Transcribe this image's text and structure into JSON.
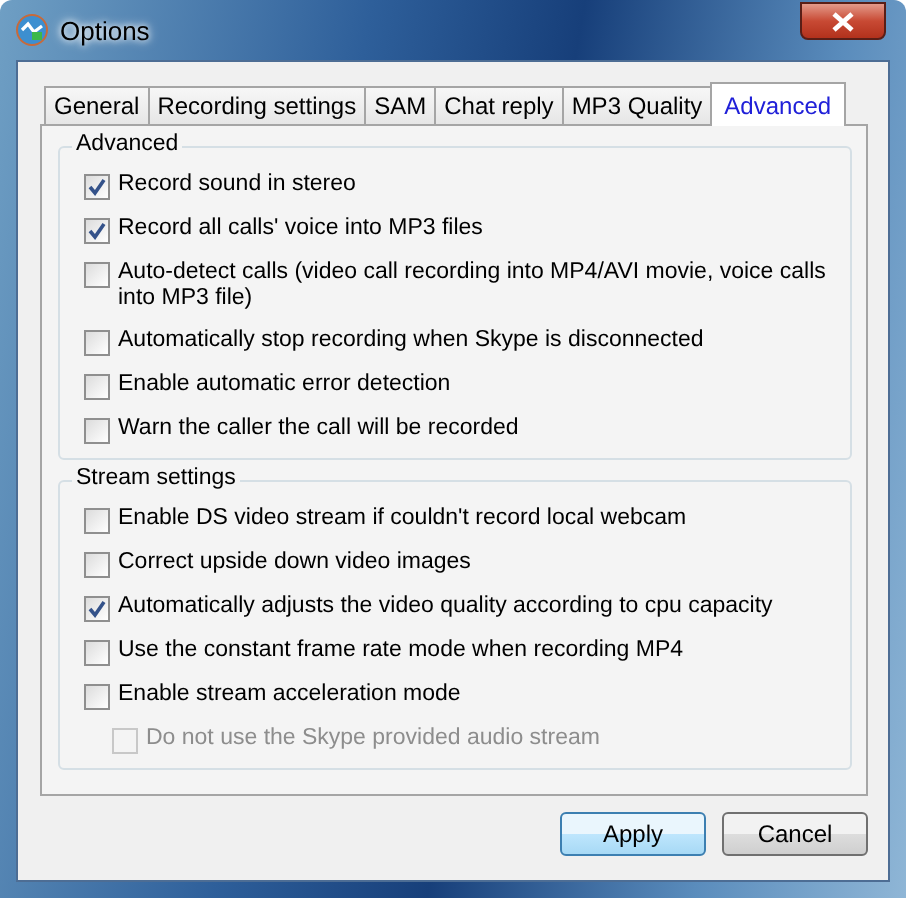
{
  "window": {
    "title": "Options"
  },
  "tabs": [
    {
      "label": "General",
      "selected": false
    },
    {
      "label": "Recording settings",
      "selected": false
    },
    {
      "label": "SAM",
      "selected": false
    },
    {
      "label": "Chat reply",
      "selected": false
    },
    {
      "label": "MP3 Quality",
      "selected": false
    },
    {
      "label": "Advanced",
      "selected": true
    }
  ],
  "groups": [
    {
      "title": "Advanced",
      "options": [
        {
          "label": "Record sound in stereo",
          "checked": true,
          "disabled": false
        },
        {
          "label": "Record all calls' voice into MP3 files",
          "checked": true,
          "disabled": false
        },
        {
          "label": "Auto-detect calls (video call recording into MP4/AVI movie, voice calls into MP3 file)",
          "checked": false,
          "disabled": false
        },
        {
          "label": "Automatically stop recording when Skype is disconnected",
          "checked": false,
          "disabled": false
        },
        {
          "label": "Enable automatic error detection",
          "checked": false,
          "disabled": false
        },
        {
          "label": "Warn the caller the call will be recorded",
          "checked": false,
          "disabled": false
        }
      ]
    },
    {
      "title": "Stream settings",
      "options": [
        {
          "label": "Enable DS video stream if couldn't record local webcam",
          "checked": false,
          "disabled": false
        },
        {
          "label": "Correct upside down video images",
          "checked": false,
          "disabled": false
        },
        {
          "label": "Automatically adjusts the video quality according to cpu capacity",
          "checked": true,
          "disabled": false
        },
        {
          "label": "Use the constant frame rate mode when recording MP4",
          "checked": false,
          "disabled": false
        },
        {
          "label": "Enable stream acceleration mode",
          "checked": false,
          "disabled": false,
          "children": [
            {
              "label": "Do not use the Skype provided audio stream",
              "checked": false,
              "disabled": true
            }
          ]
        }
      ]
    }
  ],
  "buttons": [
    {
      "label": "Apply",
      "kind": "default"
    },
    {
      "label": "Cancel",
      "kind": "normal"
    }
  ]
}
